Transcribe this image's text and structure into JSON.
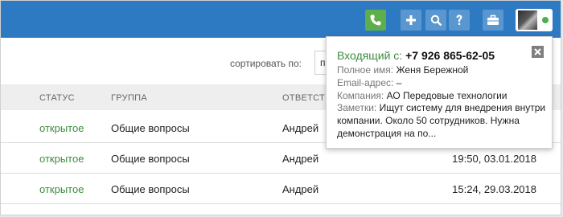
{
  "sort": {
    "label": "сортировать по:",
    "selected": "п"
  },
  "table": {
    "headers": {
      "status": "СТАТУС",
      "group": "ГРУППА",
      "responsible": "ОТВЕТСТВЕ"
    },
    "rows": [
      {
        "status": "открытое",
        "group": "Общие вопросы",
        "responsible": "Андрей",
        "date": ""
      },
      {
        "status": "открытое",
        "group": "Общие вопросы",
        "responsible": "Андрей",
        "date": "19:50, 03.01.2018"
      },
      {
        "status": "открытое",
        "group": "Общие вопросы",
        "responsible": "Андрей",
        "date": "15:24, 29.03.2018"
      }
    ]
  },
  "call_popup": {
    "title_label": "Входящий с:",
    "phone": "+7 926 865-62-05",
    "name_label": "Полное имя:",
    "name": "Женя Бережной",
    "email_label": "Email-адрес:",
    "email": "–",
    "company_label": "Компания:",
    "company": "АО Передовые технологии",
    "notes_label": "Заметки:",
    "notes": "Ищут систему для внедрения внутри компании. Около 50 сотрудников. Нужна демонстрация на по..."
  },
  "topbar_icons": [
    "phone-icon",
    "plus-icon",
    "search-icon",
    "help-icon",
    "briefcase-icon"
  ],
  "colors": {
    "topbar": "#2e7ac2",
    "phone_button": "#5fae4c",
    "status_open": "#3d8c3d",
    "online": "#4caf50"
  }
}
